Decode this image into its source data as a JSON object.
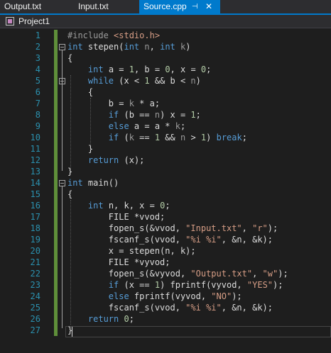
{
  "tabs": [
    {
      "label": "Output.txt",
      "active": false
    },
    {
      "label": "Input.txt",
      "active": false
    },
    {
      "label": "Source.cpp",
      "active": true
    }
  ],
  "tab_icons": {
    "pin": "⊣",
    "close": "✕"
  },
  "nav": {
    "project": "Project1"
  },
  "line_numbers": [
    "1",
    "2",
    "3",
    "4",
    "5",
    "6",
    "7",
    "8",
    "9",
    "10",
    "11",
    "12",
    "13",
    "14",
    "15",
    "16",
    "17",
    "18",
    "19",
    "20",
    "21",
    "22",
    "23",
    "24",
    "25",
    "26",
    "27"
  ],
  "colors": {
    "accent": "#007acc",
    "keyword": "#569cd6",
    "string": "#d69d85",
    "number": "#b5cea8",
    "param": "#9a9a9a",
    "line_number": "#2b91af"
  },
  "code": [
    {
      "line": 1,
      "tokens": [
        [
          "pp",
          "#include "
        ],
        [
          "str",
          "<stdio.h>"
        ]
      ]
    },
    {
      "line": 2,
      "tokens": [
        [
          "kw",
          "int"
        ],
        [
          "t",
          " stepen("
        ],
        [
          "kw",
          "int"
        ],
        [
          "t",
          " "
        ],
        [
          "par",
          "n"
        ],
        [
          "t",
          ", "
        ],
        [
          "kw",
          "int"
        ],
        [
          "t",
          " "
        ],
        [
          "par",
          "k"
        ],
        [
          "t",
          ")"
        ]
      ]
    },
    {
      "line": 3,
      "tokens": [
        [
          "t",
          "{"
        ]
      ]
    },
    {
      "line": 4,
      "tokens": [
        [
          "t",
          "    "
        ],
        [
          "kw",
          "int"
        ],
        [
          "t",
          " a = "
        ],
        [
          "num",
          "1"
        ],
        [
          "t",
          ", b = "
        ],
        [
          "num",
          "0"
        ],
        [
          "t",
          ", x = "
        ],
        [
          "num",
          "0"
        ],
        [
          "t",
          ";"
        ]
      ]
    },
    {
      "line": 5,
      "tokens": [
        [
          "t",
          "    "
        ],
        [
          "kw",
          "while"
        ],
        [
          "t",
          " (x < "
        ],
        [
          "num",
          "1"
        ],
        [
          "t",
          " && b < "
        ],
        [
          "par",
          "n"
        ],
        [
          "t",
          ")"
        ]
      ]
    },
    {
      "line": 6,
      "tokens": [
        [
          "t",
          "    {"
        ]
      ]
    },
    {
      "line": 7,
      "tokens": [
        [
          "t",
          "        b = "
        ],
        [
          "par",
          "k"
        ],
        [
          "t",
          " * a;"
        ]
      ]
    },
    {
      "line": 8,
      "tokens": [
        [
          "t",
          "        "
        ],
        [
          "kw",
          "if"
        ],
        [
          "t",
          " (b == "
        ],
        [
          "par",
          "n"
        ],
        [
          "t",
          ") x = "
        ],
        [
          "num",
          "1"
        ],
        [
          "t",
          ";"
        ]
      ]
    },
    {
      "line": 9,
      "tokens": [
        [
          "t",
          "        "
        ],
        [
          "kw",
          "else"
        ],
        [
          "t",
          " a = a * "
        ],
        [
          "par",
          "k"
        ],
        [
          "t",
          ";"
        ]
      ]
    },
    {
      "line": 10,
      "tokens": [
        [
          "t",
          "        "
        ],
        [
          "kw",
          "if"
        ],
        [
          "t",
          " ("
        ],
        [
          "par",
          "k"
        ],
        [
          "t",
          " == "
        ],
        [
          "num",
          "1"
        ],
        [
          "t",
          " && "
        ],
        [
          "par",
          "n"
        ],
        [
          "t",
          " > "
        ],
        [
          "num",
          "1"
        ],
        [
          "t",
          ") "
        ],
        [
          "kw",
          "break"
        ],
        [
          "t",
          ";"
        ]
      ]
    },
    {
      "line": 11,
      "tokens": [
        [
          "t",
          "    }"
        ]
      ]
    },
    {
      "line": 12,
      "tokens": [
        [
          "t",
          "    "
        ],
        [
          "kw",
          "return"
        ],
        [
          "t",
          " (x);"
        ]
      ]
    },
    {
      "line": 13,
      "tokens": [
        [
          "t",
          "}"
        ]
      ]
    },
    {
      "line": 14,
      "tokens": [
        [
          "kw",
          "int"
        ],
        [
          "t",
          " main()"
        ]
      ]
    },
    {
      "line": 15,
      "tokens": [
        [
          "t",
          "{"
        ]
      ]
    },
    {
      "line": 16,
      "tokens": [
        [
          "t",
          "    "
        ],
        [
          "kw",
          "int"
        ],
        [
          "t",
          " n, k, x = "
        ],
        [
          "num",
          "0"
        ],
        [
          "t",
          ";"
        ]
      ]
    },
    {
      "line": 17,
      "tokens": [
        [
          "t",
          "        FILE *vvod;"
        ]
      ]
    },
    {
      "line": 18,
      "tokens": [
        [
          "t",
          "        fopen_s(&vvod, "
        ],
        [
          "str",
          "\"Input.txt\""
        ],
        [
          "t",
          ", "
        ],
        [
          "str",
          "\"r\""
        ],
        [
          "t",
          ");"
        ]
      ]
    },
    {
      "line": 19,
      "tokens": [
        [
          "t",
          "        fscanf_s(vvod, "
        ],
        [
          "str",
          "\"%i %i\""
        ],
        [
          "t",
          ", &n, &k);"
        ]
      ]
    },
    {
      "line": 20,
      "tokens": [
        [
          "t",
          "        x = stepen(n, k);"
        ]
      ]
    },
    {
      "line": 21,
      "tokens": [
        [
          "t",
          "        FILE *vyvod;"
        ]
      ]
    },
    {
      "line": 22,
      "tokens": [
        [
          "t",
          "        fopen_s(&vyvod, "
        ],
        [
          "str",
          "\"Output.txt\""
        ],
        [
          "t",
          ", "
        ],
        [
          "str",
          "\"w\""
        ],
        [
          "t",
          ");"
        ]
      ]
    },
    {
      "line": 23,
      "tokens": [
        [
          "t",
          "        "
        ],
        [
          "kw",
          "if"
        ],
        [
          "t",
          " (x == "
        ],
        [
          "num",
          "1"
        ],
        [
          "t",
          ") fprintf(vyvod, "
        ],
        [
          "str",
          "\"YES\""
        ],
        [
          "t",
          ");"
        ]
      ]
    },
    {
      "line": 24,
      "tokens": [
        [
          "t",
          "        "
        ],
        [
          "kw",
          "else"
        ],
        [
          "t",
          " fprintf(vyvod, "
        ],
        [
          "str",
          "\"NO\""
        ],
        [
          "t",
          ");"
        ]
      ]
    },
    {
      "line": 25,
      "tokens": [
        [
          "t",
          "        fscanf_s(vvod, "
        ],
        [
          "str",
          "\"%i %i\""
        ],
        [
          "t",
          ", &n, &k);"
        ]
      ]
    },
    {
      "line": 26,
      "tokens": [
        [
          "t",
          "    "
        ],
        [
          "kw",
          "return"
        ],
        [
          "t",
          " "
        ],
        [
          "num",
          "0"
        ],
        [
          "t",
          ";"
        ]
      ]
    },
    {
      "line": 27,
      "tokens": [
        [
          "t",
          "}"
        ]
      ]
    }
  ]
}
